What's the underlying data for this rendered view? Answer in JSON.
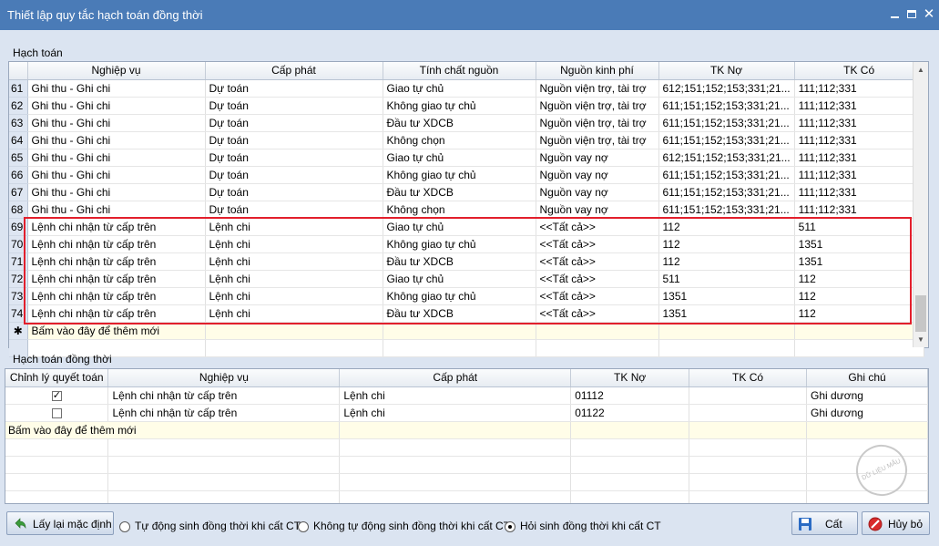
{
  "window": {
    "title": "Thiết lập quy tắc hạch toán đồng thời"
  },
  "top_section": {
    "label": "Hạch toán",
    "columns": [
      "Nghiệp vụ",
      "Cấp phát",
      "Tính chất nguồn",
      "Nguồn kinh phí",
      "TK Nợ",
      "TK Có"
    ],
    "rows": [
      {
        "n": "61",
        "cells": [
          "Ghi thu - Ghi chi",
          "Dự toán",
          "Giao tự chủ",
          "Nguồn viện trợ, tài trợ",
          "612;151;152;153;331;21...",
          "111;112;331"
        ]
      },
      {
        "n": "62",
        "cells": [
          "Ghi thu - Ghi chi",
          "Dự toán",
          "Không giao tự chủ",
          "Nguồn viện trợ, tài trợ",
          "611;151;152;153;331;21...",
          "111;112;331"
        ]
      },
      {
        "n": "63",
        "cells": [
          "Ghi thu - Ghi chi",
          "Dự toán",
          "Đầu tư XDCB",
          "Nguồn viện trợ, tài trợ",
          "611;151;152;153;331;21...",
          "111;112;331"
        ]
      },
      {
        "n": "64",
        "cells": [
          "Ghi thu - Ghi chi",
          "Dự toán",
          "Không chọn",
          "Nguồn viện trợ, tài trợ",
          "611;151;152;153;331;21...",
          "111;112;331"
        ]
      },
      {
        "n": "65",
        "cells": [
          "Ghi thu - Ghi chi",
          "Dự toán",
          "Giao tự chủ",
          "Nguồn vay nợ",
          "612;151;152;153;331;21...",
          "111;112;331"
        ]
      },
      {
        "n": "66",
        "cells": [
          "Ghi thu - Ghi chi",
          "Dự toán",
          "Không giao tự chủ",
          "Nguồn vay nợ",
          "611;151;152;153;331;21...",
          "111;112;331"
        ]
      },
      {
        "n": "67",
        "cells": [
          "Ghi thu - Ghi chi",
          "Dự toán",
          "Đầu tư XDCB",
          "Nguồn vay nợ",
          "611;151;152;153;331;21...",
          "111;112;331"
        ]
      },
      {
        "n": "68",
        "cells": [
          "Ghi thu - Ghi chi",
          "Dự toán",
          "Không chọn",
          "Nguồn vay nợ",
          "611;151;152;153;331;21...",
          "111;112;331"
        ]
      },
      {
        "n": "69",
        "cells": [
          "Lệnh chi nhận từ cấp trên",
          "Lệnh chi",
          "Giao tự chủ",
          "<<Tất cả>>",
          "112",
          "511"
        ]
      },
      {
        "n": "70",
        "cells": [
          "Lệnh chi nhận từ cấp trên",
          "Lệnh chi",
          "Không giao tự chủ",
          "<<Tất cả>>",
          "112",
          "1351"
        ]
      },
      {
        "n": "71",
        "cells": [
          "Lệnh chi nhận từ cấp trên",
          "Lệnh chi",
          "Đầu tư XDCB",
          "<<Tất cả>>",
          "112",
          "1351"
        ]
      },
      {
        "n": "72",
        "cells": [
          "Lệnh chi nhận từ cấp trên",
          "Lệnh chi",
          "Giao tự chủ",
          "<<Tất cả>>",
          "511",
          "112"
        ]
      },
      {
        "n": "73",
        "cells": [
          "Lệnh chi nhận từ cấp trên",
          "Lệnh chi",
          "Không giao tự chủ",
          "<<Tất cả>>",
          "1351",
          "112"
        ]
      },
      {
        "n": "74",
        "cells": [
          "Lệnh chi nhận từ cấp trên",
          "Lệnh chi",
          "Đầu tư XDCB",
          "<<Tất cả>>",
          "1351",
          "112"
        ]
      }
    ],
    "new_row_marker": "✱",
    "new_row_text": "Bấm vào đây để thêm mới"
  },
  "bottom_section": {
    "label": "Hạch toán đồng thời",
    "columns": [
      "Chỉnh lý quyết toán",
      "Nghiệp vụ",
      "Cấp phát",
      "TK Nợ",
      "TK Có",
      "Ghi chú"
    ],
    "rows": [
      {
        "checked": true,
        "cells": [
          "Lệnh chi nhận từ cấp trên",
          "Lệnh chi",
          "01112",
          "",
          "Ghi dương"
        ]
      },
      {
        "checked": false,
        "cells": [
          "Lệnh chi nhận từ cấp trên",
          "Lệnh chi",
          "01122",
          "",
          "Ghi dương"
        ]
      }
    ],
    "new_row_text": "Bấm vào đây để thêm mới"
  },
  "footer": {
    "reset_button": "Lấy lại mặc định",
    "radio_options": [
      {
        "label": "Tự động sinh đồng thời khi cất CT",
        "selected": false
      },
      {
        "label": "Không tự động sinh đồng thời khi cất CT",
        "selected": false
      },
      {
        "label": "Hỏi sinh đồng thời khi cất CT",
        "selected": true
      }
    ],
    "save_button": "Cất",
    "cancel_button": "Hủy bỏ"
  },
  "watermark": "DỮ LIỆU MẪU",
  "colors": {
    "titlebar": "#4a7bb7",
    "highlight_border": "#e21f2c",
    "new_row_bg": "#fffde8",
    "row_number_bg": "#dee6f2"
  }
}
